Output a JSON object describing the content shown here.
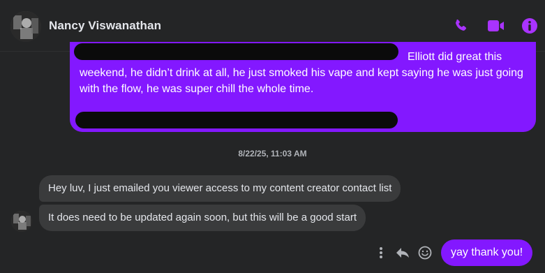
{
  "header": {
    "contact_name": "Nancy Viswanathan",
    "icons": [
      "phone-icon",
      "video-icon",
      "info-icon"
    ],
    "accent_color": "#a933ff"
  },
  "thread": {
    "sent_big": {
      "line1_visible_tail": "Elliott did great this",
      "paragraph": "weekend, he didn’t drink at all, he just smoked his vape and kept saying he was just going with the flow, he was super chill the whole time."
    },
    "timestamp": "8/22/25, 11:03 AM",
    "received": [
      "Hey luv, I just emailed you viewer access to my content creator contact list",
      "It does need to be updated again soon, but this will be a good start"
    ],
    "last_sent": "yay thank you!",
    "message_actions": [
      "more-options-icon",
      "reply-icon",
      "emoji-react-icon"
    ]
  },
  "colors": {
    "background": "#242526",
    "sent_bubble": "#8318ff",
    "received_bubble": "#3a3b3c",
    "redaction": "#0b0b0b"
  }
}
